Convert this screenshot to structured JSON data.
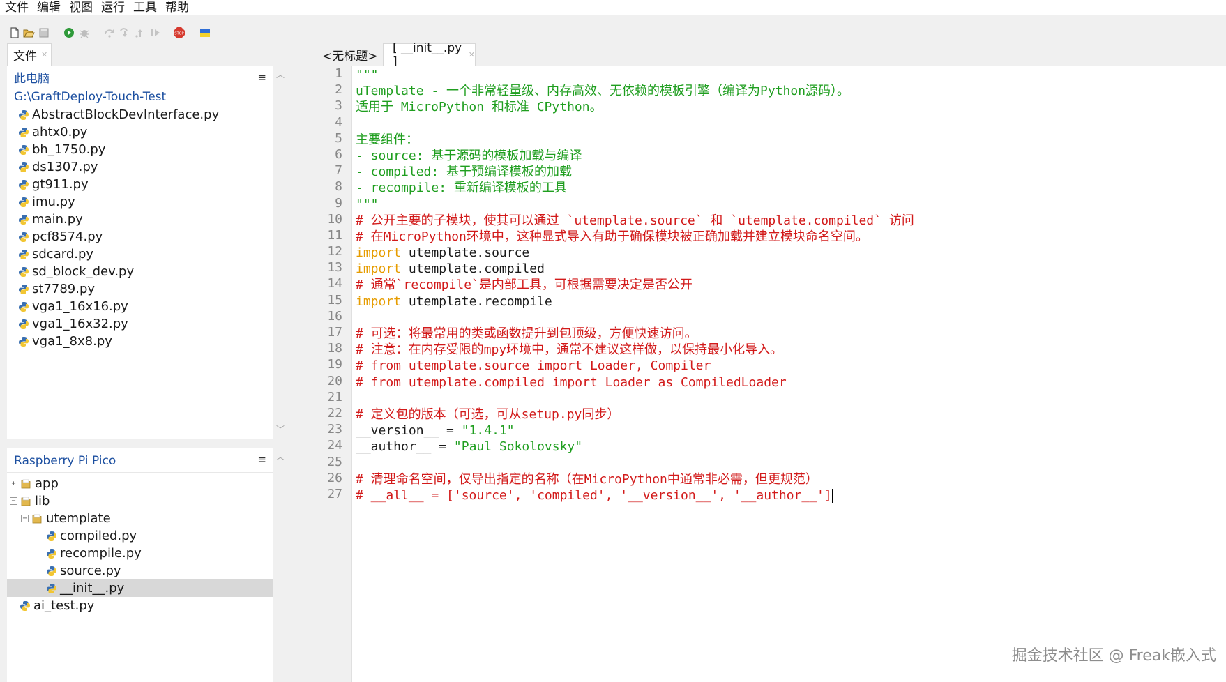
{
  "menu": [
    "文件",
    "编辑",
    "视图",
    "运行",
    "工具",
    "帮助"
  ],
  "toolbar": {
    "icons": [
      "new-file-icon",
      "open-folder-icon",
      "save-icon",
      "run-icon",
      "debug-icon",
      "step-over-icon",
      "step-into-icon",
      "step-out-icon",
      "resume-icon",
      "stop-icon",
      "flag-icon"
    ]
  },
  "files_panel": {
    "tab_label": "文件",
    "computer_label": "此电脑",
    "path": "G:\\GraftDeploy-Touch-Test",
    "files": [
      "AbstractBlockDevInterface.py",
      "ahtx0.py",
      "bh_1750.py",
      "ds1307.py",
      "gt911.py",
      "imu.py",
      "main.py",
      "pcf8574.py",
      "sdcard.py",
      "sd_block_dev.py",
      "st7789.py",
      "vga1_16x16.py",
      "vga1_16x32.py",
      "vga1_8x8.py"
    ]
  },
  "device_panel": {
    "title": "Raspberry Pi Pico",
    "items": [
      {
        "label": "app",
        "type": "folder",
        "expander": "+"
      },
      {
        "label": "lib",
        "type": "folder",
        "expander": "−"
      },
      {
        "label": "utemplate",
        "type": "folder",
        "expander": "−"
      },
      {
        "label": "compiled.py",
        "type": "file"
      },
      {
        "label": "recompile.py",
        "type": "file"
      },
      {
        "label": "source.py",
        "type": "file"
      },
      {
        "label": "__init__.py",
        "type": "file",
        "selected": true
      },
      {
        "label": "ai_test.py",
        "type": "file"
      }
    ]
  },
  "editor": {
    "tabs": [
      "<无标题>",
      "[ __init__.py ]"
    ],
    "lines": [
      "\"\"\"",
      "uTemplate - 一个非常轻量级、内存高效、无依赖的模板引擎（编译为Python源码）。",
      "适用于 MicroPython 和标准 CPython。",
      "",
      "主要组件：",
      "- source: 基于源码的模板加载与编译",
      "- compiled: 基于预编译模板的加载",
      "- recompile: 重新编译模板的工具",
      "\"\"\"",
      "# 公开主要的子模块，使其可以通过 `utemplate.source` 和 `utemplate.compiled` 访问",
      "# 在MicroPython环境中，这种显式导入有助于确保模块被正确加载并建立模块命名空间。",
      "import utemplate.source",
      "import utemplate.compiled",
      "# 通常`recompile`是内部工具，可根据需要决定是否公开",
      "import utemplate.recompile",
      "",
      "# 可选：将最常用的类或函数提升到包顶级，方便快速访问。",
      "# 注意：在内存受限的mpy环境中，通常不建议这样做，以保持最小化导入。",
      "# from utemplate.source import Loader, Compiler",
      "# from utemplate.compiled import Loader as CompiledLoader",
      "",
      "# 定义包的版本（可选，可从setup.py同步）",
      "__version__ = \"1.4.1\"",
      "__author__ = \"Paul Sokolovsky\"",
      "",
      "# 清理命名空间，仅导出指定的名称（在MicroPython中通常非必需，但更规范）",
      "# __all__ = ['source', 'compiled', '__version__', '__author__']"
    ]
  },
  "watermark": "掘金技术社区 @ Freak嵌入式",
  "colors": {
    "docstring": "#1f9e1f",
    "comment": "#d21a1a",
    "keyword": "#e69c00",
    "path_link": "#1c4fa0"
  }
}
